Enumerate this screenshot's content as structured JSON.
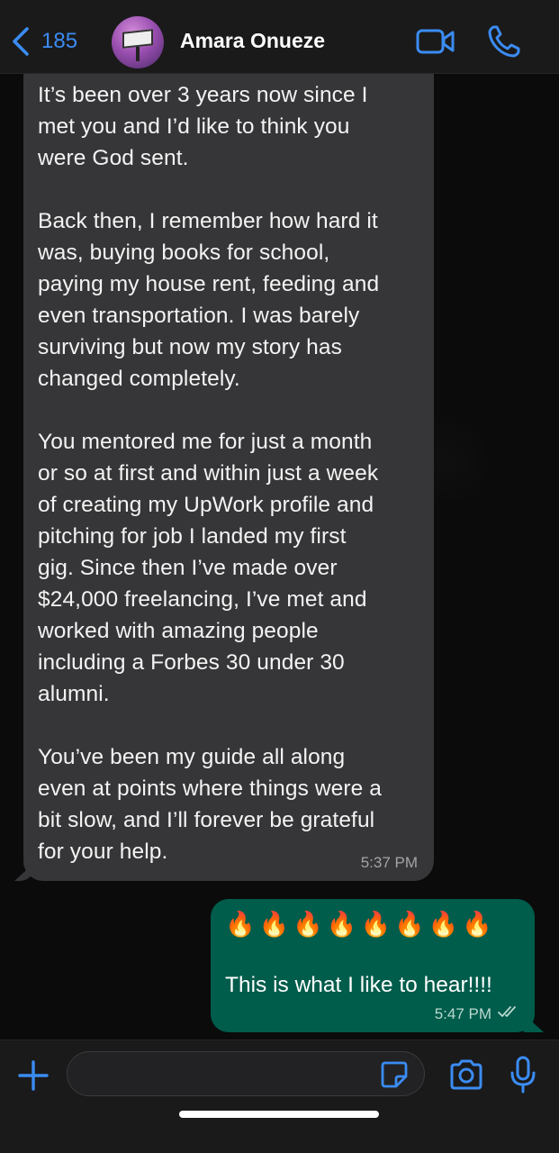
{
  "colors": {
    "accent": "#3b8cf3",
    "incoming_bubble": "#363638",
    "outgoing_bubble": "#005c4b",
    "background": "#0b0b0b"
  },
  "header": {
    "back_count": "185",
    "contact_name": "Amara Onueze",
    "icons": [
      "chevron-left-icon",
      "video-call-icon",
      "phone-icon"
    ]
  },
  "messages": [
    {
      "direction": "incoming",
      "text": "It’s been over 3 years now since I\nmet you and I’d like to think you\nwere God sent.\n\nBack then, I remember how hard it\nwas, buying books for school,\npaying my house rent, feeding and\neven transportation. I was barely\nsurviving but now my story has\nchanged completely.\n\nYou mentored me for just a month\nor so at first and within just a week\nof creating my UpWork profile and\npitching for job I landed my first\ngig. Since then I’ve made over\n$24,000 freelancing, I’ve met and\nworked with amazing people\nincluding a Forbes 30 under 30\nalumni.\n\nYou’ve been my guide all along\neven at points where things were a\nbit slow, and I’ll forever be grateful\nfor your help.",
      "time": "5:37 PM"
    },
    {
      "direction": "outgoing",
      "emojis": "🔥🔥🔥🔥🔥🔥🔥🔥",
      "text": "This is what I like to hear!!!!",
      "time": "5:47 PM",
      "status": "read"
    }
  ],
  "input_bar": {
    "placeholder": "",
    "icons": [
      "plus-icon",
      "sticker-icon",
      "camera-icon",
      "microphone-icon"
    ]
  }
}
